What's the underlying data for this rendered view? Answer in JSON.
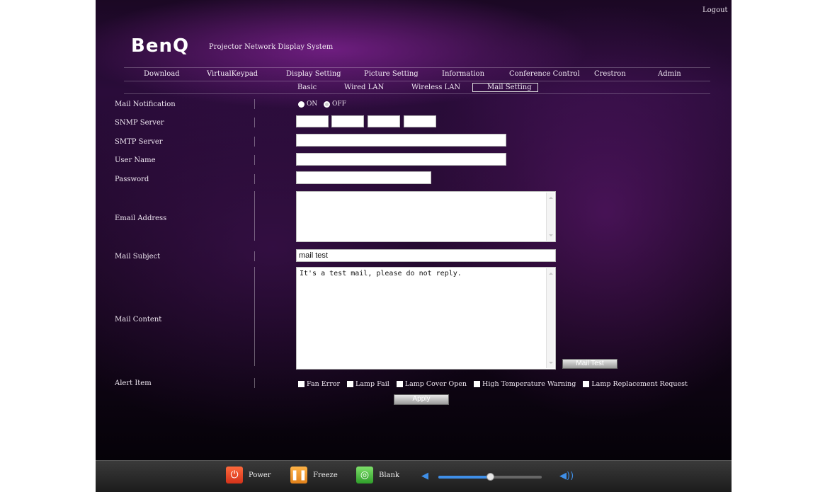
{
  "header": {
    "logout": "Logout",
    "brand": "BenQ",
    "tagline": "Projector Network Display System"
  },
  "nav": {
    "main": [
      "Download",
      "VirtualKeypad",
      "Display Setting",
      "Picture Setting",
      "Information",
      "Conference Control",
      "Crestron",
      "Admin"
    ],
    "sub": [
      "Basic",
      "Wired LAN",
      "Wireless LAN",
      "Mail Setting"
    ],
    "active_sub": "Mail Setting"
  },
  "form": {
    "mail_notification": {
      "label": "Mail Notification",
      "on_label": "ON",
      "off_label": "OFF",
      "selected": "OFF"
    },
    "snmp_server": {
      "label": "SNMP Server",
      "octets": [
        "",
        "",
        "",
        ""
      ]
    },
    "smtp_server": {
      "label": "SMTP Server",
      "value": ""
    },
    "user_name": {
      "label": "User Name",
      "value": ""
    },
    "password": {
      "label": "Password",
      "value": ""
    },
    "email_address": {
      "label": "Email Address",
      "value": ""
    },
    "mail_subject": {
      "label": "Mail Subject",
      "value": "mail test"
    },
    "mail_content": {
      "label": "Mail Content",
      "value": "It's a test mail, please do not reply."
    },
    "mail_test_button": "Mail Test",
    "alert_item": {
      "label": "Alert Item",
      "items": [
        "Fan Error",
        "Lamp Fail",
        "Lamp Cover Open",
        "High Temperature Warning",
        "Lamp Replacement Request"
      ]
    },
    "apply_button": "Apply"
  },
  "bottom_bar": {
    "power": "Power",
    "freeze": "Freeze",
    "blank": "Blank",
    "volume_level": 0.5
  },
  "colors": {
    "background": "#2a0c3a",
    "accent_blue": "#3f8fe8",
    "power": "#e0401f",
    "freeze": "#f0962a",
    "blank": "#3fb032"
  }
}
